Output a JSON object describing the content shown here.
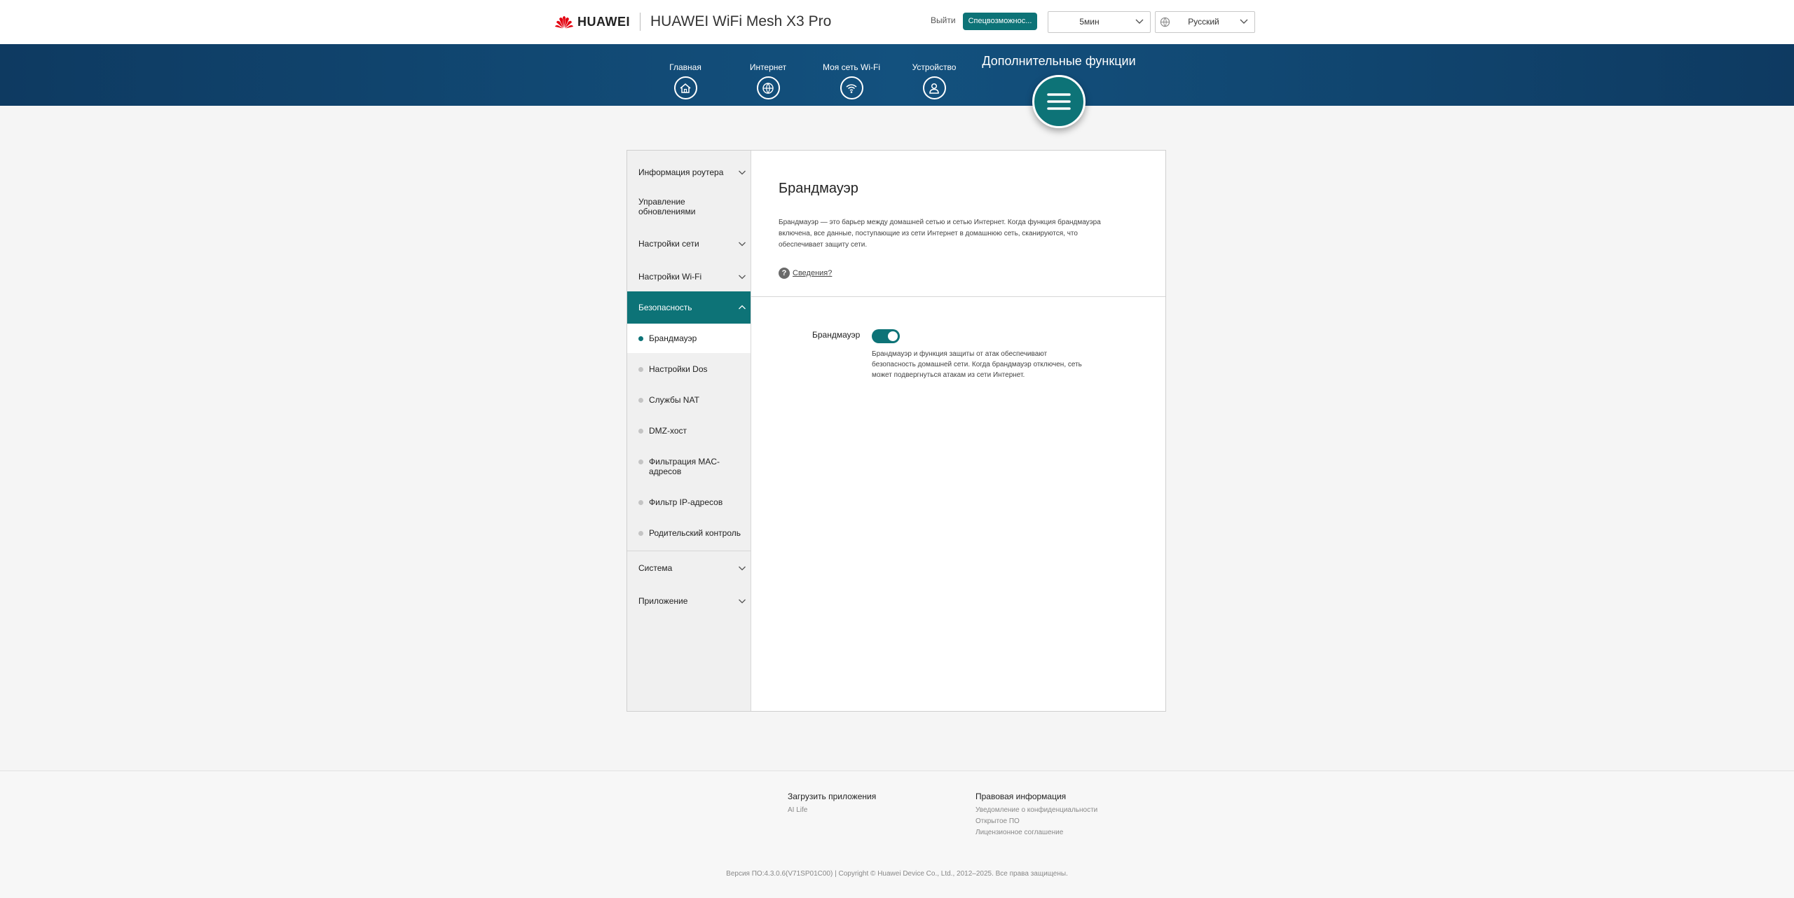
{
  "header": {
    "brand": "HUAWEI",
    "product": "HUAWEI WiFi Mesh X3 Pro",
    "logout": "Выйти",
    "accessibility": "Спецвозможнос...",
    "timeout_value": "5мин",
    "language_value": "Русский"
  },
  "nav": {
    "items": [
      {
        "label": "Главная",
        "icon": "home-icon"
      },
      {
        "label": "Интернет",
        "icon": "globe-icon"
      },
      {
        "label": "Моя сеть Wi-Fi",
        "icon": "wifi-icon"
      },
      {
        "label": "Устройство",
        "icon": "user-icon"
      }
    ],
    "active_label": "Дополнительные функции",
    "active_icon": "menu-icon"
  },
  "sidebar": {
    "sections": [
      {
        "label": "Информация роутера"
      },
      {
        "label": "Управление обновлениями"
      },
      {
        "label": "Настройки сети"
      },
      {
        "label": "Настройки Wi-Fi"
      },
      {
        "label": "Безопасность"
      },
      {
        "label": "Система"
      },
      {
        "label": "Приложение"
      }
    ],
    "sub_items": [
      {
        "label": "Брандмауэр"
      },
      {
        "label": "Настройки Dos"
      },
      {
        "label": "Службы NAT"
      },
      {
        "label": "DMZ-хост"
      },
      {
        "label": "Фильтрация MAC-адресов"
      },
      {
        "label": "Фильтр IP-адресов"
      },
      {
        "label": "Родительский контроль"
      }
    ]
  },
  "content": {
    "title": "Брандмауэр",
    "description": "Брандмауэр — это барьер между домашней сетью и сетью Интернет. Когда функция брандмауэра включена, все данные, поступающие из сети Интернет в домашнюю сеть, сканируются, что обеспечивает защиту сети.",
    "help_link": "Сведения?",
    "firewall_label": "Брандмауэр",
    "firewall_enabled": true,
    "firewall_note": "Брандмауэр и функция защиты от атак обеспечивают безопасность домашней сети. Когда брандмауэр отключен, сеть может подвергнуться атакам из сети Интернет."
  },
  "footer": {
    "download_head": "Загрузить приложения",
    "download_links": [
      "AI Life"
    ],
    "legal_head": "Правовая информация",
    "legal_links": [
      "Уведомление о конфиденциальности",
      "Открытое ПО",
      "Лицензионное соглашение"
    ],
    "copyright": "Версия ПО:4.3.0.6(V71SP01C00) | Copyright © Huawei Device Co., Ltd., 2012–2025. Все права защищены."
  },
  "colors": {
    "accent": "#0d7377",
    "nav_band": "#13517e"
  }
}
